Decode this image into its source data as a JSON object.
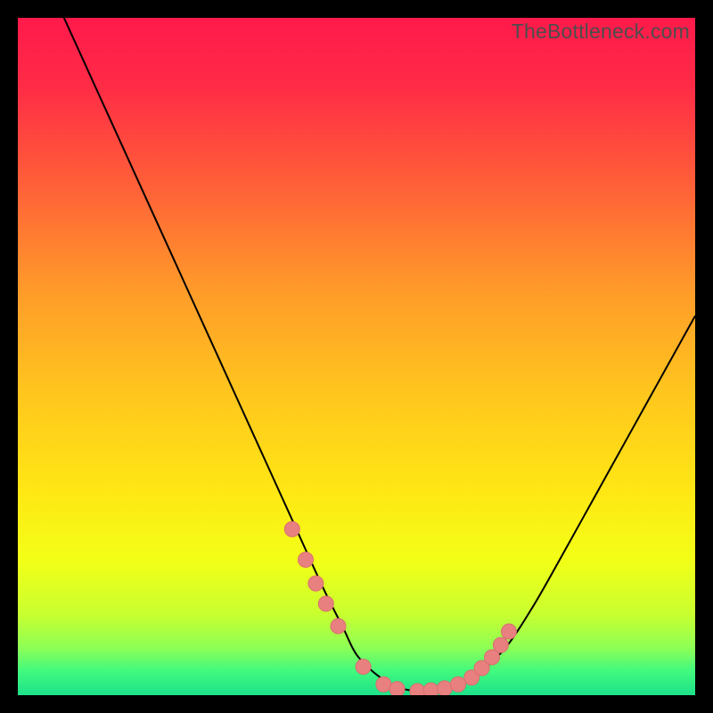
{
  "watermark": "TheBottleneck.com",
  "colors": {
    "background": "#000000",
    "gradient_stops": [
      {
        "offset": 0.0,
        "color": "#ff1a4b"
      },
      {
        "offset": 0.1,
        "color": "#ff2b46"
      },
      {
        "offset": 0.25,
        "color": "#ff6138"
      },
      {
        "offset": 0.4,
        "color": "#ff9a2a"
      },
      {
        "offset": 0.55,
        "color": "#ffc51e"
      },
      {
        "offset": 0.7,
        "color": "#ffe714"
      },
      {
        "offset": 0.8,
        "color": "#f3ff17"
      },
      {
        "offset": 0.88,
        "color": "#c9ff2f"
      },
      {
        "offset": 0.93,
        "color": "#8eff56"
      },
      {
        "offset": 0.965,
        "color": "#40f97e"
      },
      {
        "offset": 1.0,
        "color": "#1de18a"
      }
    ],
    "curve": "#000000",
    "marker_fill": "#e98080",
    "marker_stroke": "#d96f6f",
    "watermark": "#4d4d4d"
  },
  "chart_data": {
    "type": "line",
    "title": "",
    "xlabel": "",
    "ylabel": "",
    "xlim": [
      0,
      100
    ],
    "ylim": [
      0,
      100
    ],
    "grid": false,
    "legend": false,
    "series": [
      {
        "name": "bottleneck-curve",
        "x": [
          0,
          5,
          10,
          15,
          20,
          25,
          30,
          35,
          40,
          45,
          48,
          50,
          53,
          56,
          59,
          62,
          65,
          68,
          72,
          76,
          80,
          85,
          90,
          95,
          100
        ],
        "y": [
          115,
          104,
          93,
          82,
          71,
          60,
          49,
          38,
          27,
          16,
          10,
          6,
          3,
          1.2,
          0.6,
          0.6,
          1.4,
          3.2,
          7,
          13,
          20,
          29,
          38,
          47,
          56
        ]
      }
    ],
    "markers": {
      "name": "highlighted-points",
      "x": [
        40.5,
        42.5,
        44.0,
        45.5,
        47.3,
        51.0,
        54.0,
        56.0,
        59.0,
        61.0,
        63.0,
        65.0,
        67.0,
        68.5,
        70.0,
        71.3,
        72.5
      ],
      "y": [
        24.5,
        20.0,
        16.5,
        13.5,
        10.2,
        4.2,
        1.6,
        0.9,
        0.6,
        0.7,
        1.0,
        1.6,
        2.6,
        4.0,
        5.6,
        7.4,
        9.4
      ]
    }
  }
}
